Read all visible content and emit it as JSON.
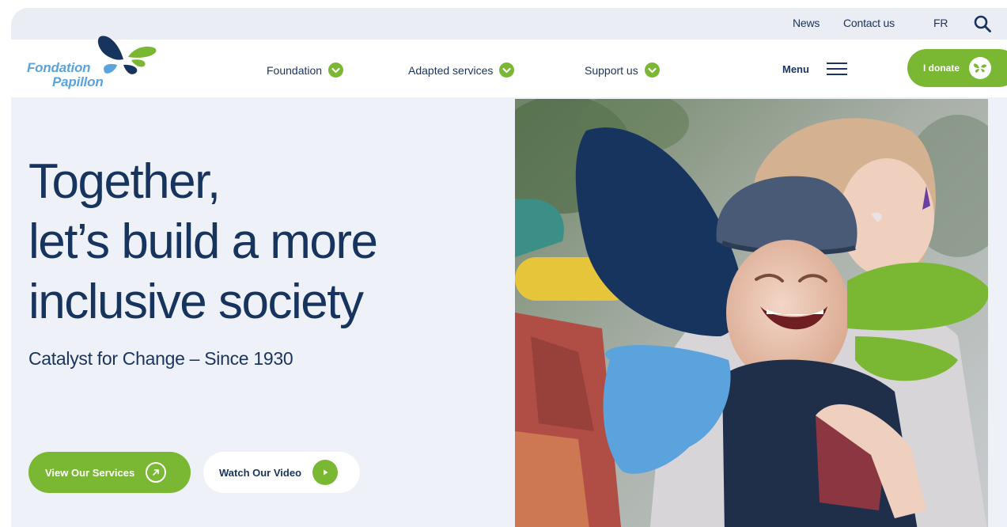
{
  "utility_nav": {
    "news": "News",
    "contact": "Contact us",
    "language": "FR"
  },
  "logo": {
    "line1": "Fondation",
    "line2": "Papillon"
  },
  "main_nav": {
    "items": [
      {
        "label": "Foundation"
      },
      {
        "label": "Adapted services"
      },
      {
        "label": "Support us"
      }
    ],
    "menu_label": "Menu",
    "donate_label": "I donate"
  },
  "hero": {
    "title_lines": [
      "Together,",
      "let’s build a more",
      "inclusive society"
    ],
    "tagline": "Catalyst for Change – Since 1930",
    "primary_button": "View Our Services",
    "secondary_button": "Watch Our Video"
  },
  "colors": {
    "brand_green": "#7ab733",
    "brand_navy": "#17345f",
    "brand_light_blue": "#5aa3dd",
    "page_background": "#eef1f7"
  },
  "icons": {
    "search": "search-icon",
    "nav_chevron": "chevron-down-icon",
    "menu": "hamburger-icon",
    "donate": "butterfly-icon",
    "services": "arrow-up-right-icon",
    "video": "play-icon"
  }
}
